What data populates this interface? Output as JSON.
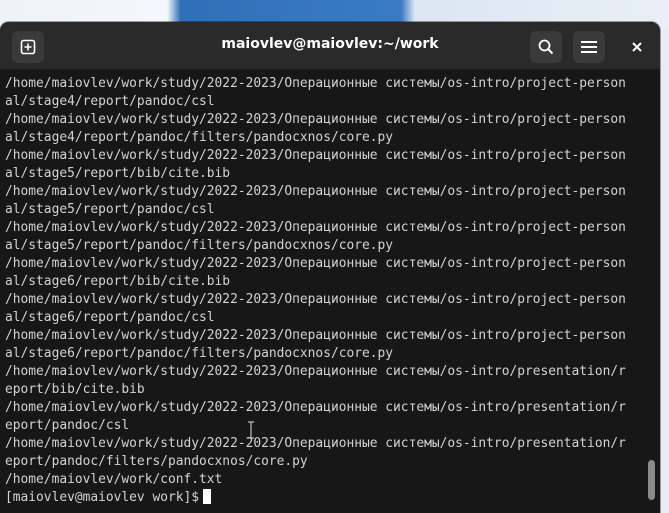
{
  "window": {
    "title": "maiovlev@maiovlev:~/work"
  },
  "icons": {
    "new_tab": "new-tab-icon",
    "search": "search-icon",
    "menu": "hamburger-menu-icon",
    "close": "close-icon"
  },
  "terminal": {
    "lines": [
      "/home/maiovlev/work/study/2022-2023/Операционные системы/os-intro/project-person",
      "al/stage4/report/pandoc/csl",
      "/home/maiovlev/work/study/2022-2023/Операционные системы/os-intro/project-person",
      "al/stage4/report/pandoc/filters/pandocxnos/core.py",
      "/home/maiovlev/work/study/2022-2023/Операционные системы/os-intro/project-person",
      "al/stage5/report/bib/cite.bib",
      "/home/maiovlev/work/study/2022-2023/Операционные системы/os-intro/project-person",
      "al/stage5/report/pandoc/csl",
      "/home/maiovlev/work/study/2022-2023/Операционные системы/os-intro/project-person",
      "al/stage5/report/pandoc/filters/pandocxnos/core.py",
      "/home/maiovlev/work/study/2022-2023/Операционные системы/os-intro/project-person",
      "al/stage6/report/bib/cite.bib",
      "/home/maiovlev/work/study/2022-2023/Операционные системы/os-intro/project-person",
      "al/stage6/report/pandoc/csl",
      "/home/maiovlev/work/study/2022-2023/Операционные системы/os-intro/project-person",
      "al/stage6/report/pandoc/filters/pandocxnos/core.py",
      "/home/maiovlev/work/study/2022-2023/Операционные системы/os-intro/presentation/r",
      "eport/bib/cite.bib",
      "/home/maiovlev/work/study/2022-2023/Операционные системы/os-intro/presentation/r",
      "eport/pandoc/csl",
      "/home/maiovlev/work/study/2022-2023/Операционные системы/os-intro/presentation/r",
      "eport/pandoc/filters/pandocxnos/core.py",
      "/home/maiovlev/work/conf.txt"
    ],
    "prompt": "[maiovlev@maiovlev work]$"
  }
}
